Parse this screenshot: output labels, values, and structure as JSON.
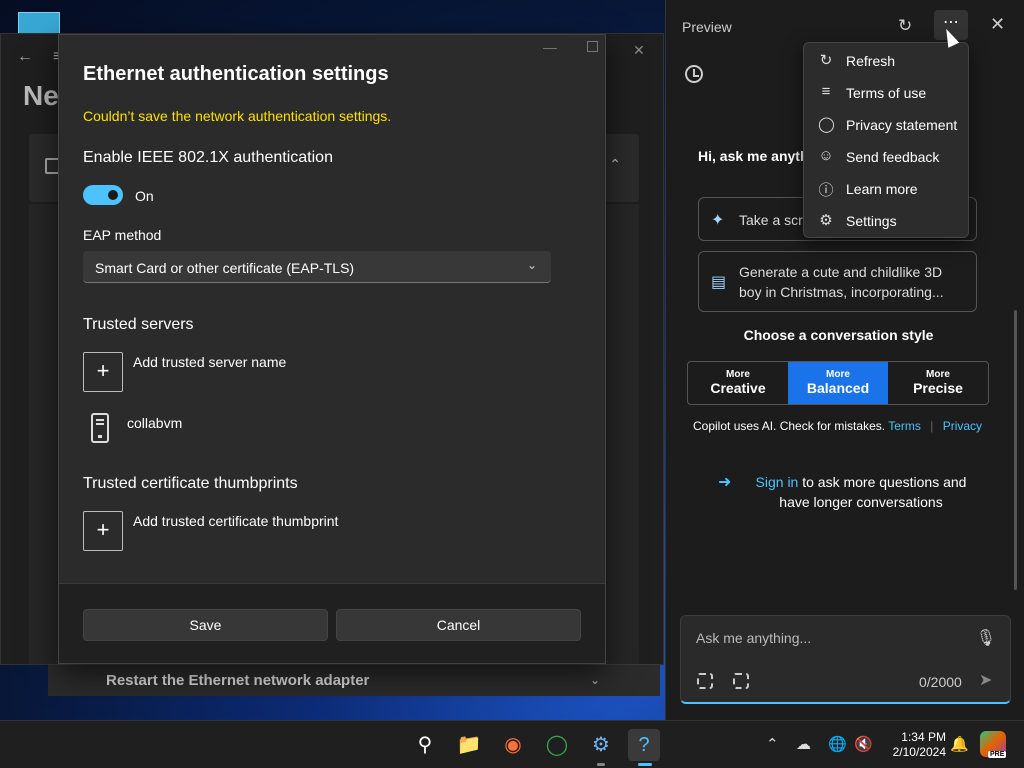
{
  "background_window": {
    "title_partial": "Ne",
    "restart_label": "Restart the Ethernet network adapter"
  },
  "dialog": {
    "title": "Ethernet authentication settings",
    "error": "Couldn’t save the network authentication settings.",
    "enable_label": "Enable IEEE 802.1X authentication",
    "toggle_state": "On",
    "eap_label": "EAP method",
    "eap_value": "Smart Card or other certificate (EAP-TLS)",
    "trusted_servers_label": "Trusted servers",
    "add_server_label": "Add trusted server name",
    "server_name": "collabvm",
    "thumbprints_label": "Trusted certificate thumbprints",
    "add_thumbprint_label": "Add trusted certificate thumbprint",
    "save_label": "Save",
    "cancel_label": "Cancel"
  },
  "copilot": {
    "title": "Preview",
    "greeting": "Hi, ask me anything or choose a suggestion to get started",
    "suggestions": [
      {
        "icon": "sparkle-icon",
        "text": "Take a screenshot"
      },
      {
        "icon": "image-icon",
        "text": "Generate a cute and childlike 3D boy in Christmas, incorporating..."
      }
    ],
    "style_title": "Choose a conversation style",
    "styles": [
      {
        "small": "More",
        "big": "Creative"
      },
      {
        "small": "More",
        "big": "Balanced"
      },
      {
        "small": "More",
        "big": "Precise"
      }
    ],
    "disclaimer_text": "Copilot uses AI. Check for mistakes.",
    "terms_link": "Terms",
    "privacy_link": "Privacy",
    "signin_link": "Sign in",
    "signin_rest": "to ask more questions and have longer conversations",
    "input_placeholder": "Ask me anything...",
    "char_count": "0/2000"
  },
  "menu": {
    "items": [
      {
        "icon": "refresh-icon",
        "label": "Refresh"
      },
      {
        "icon": "document-icon",
        "label": "Terms of use"
      },
      {
        "icon": "shield-icon",
        "label": "Privacy statement"
      },
      {
        "icon": "feedback-icon",
        "label": "Send feedback"
      },
      {
        "icon": "info-icon",
        "label": "Learn more"
      },
      {
        "icon": "gear-icon",
        "label": "Settings"
      }
    ]
  },
  "taskbar": {
    "time": "1:34 PM",
    "date": "2/10/2024",
    "copilot_badge": "PRE"
  },
  "colors": {
    "accent": "#4cc2ff",
    "error": "#fce100",
    "active_style": "#1a73e8"
  }
}
